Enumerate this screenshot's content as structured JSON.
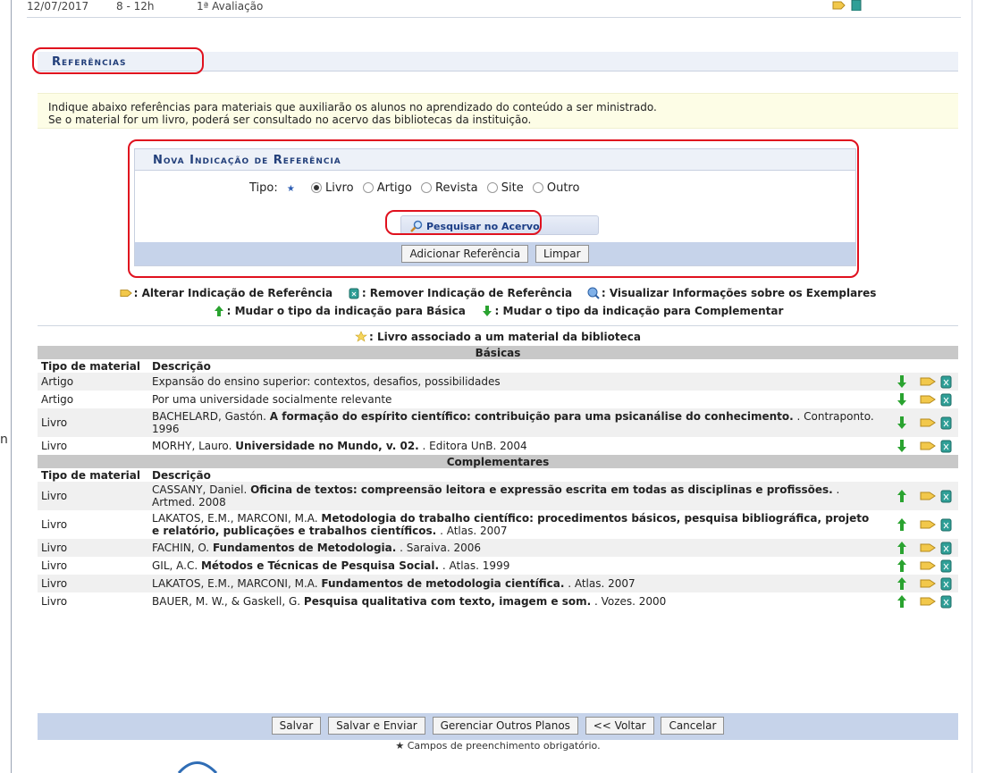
{
  "top_row": {
    "date": "12/07/2017",
    "time": "8 - 12h",
    "desc": "1ª Avaliação"
  },
  "left_margin_text": "n",
  "section_title": "Referências",
  "info_lines": [
    "Indique abaixo referências para materiais que auxiliarão os alunos no aprendizado do conteúdo a ser ministrado.",
    "Se o material for um livro, poderá ser consultado no acervo das bibliotecas da instituição."
  ],
  "form": {
    "title": "Nova Indicação de Referência",
    "tipo_label": "Tipo:",
    "required_mark": "★",
    "options": [
      "Livro",
      "Artigo",
      "Revista",
      "Site",
      "Outro"
    ],
    "selected_option": "Livro",
    "search_button": "Pesquisar no Acervo",
    "add_button": "Adicionar Referência",
    "clear_button": "Limpar"
  },
  "legend": {
    "edit": ": Alterar Indicação de Referência",
    "remove": ": Remover Indicação de Referência",
    "view": ": Visualizar Informações sobre os Exemplares",
    "to_basic": ": Mudar o tipo da indicação para Básica",
    "to_complementary": ": Mudar o tipo da indicação para Complementar",
    "library": ": Livro associado a um material da biblioteca"
  },
  "columns": {
    "type": "Tipo de material",
    "description": "Descrição"
  },
  "groups": [
    {
      "title": "Básicas",
      "arrow": "down",
      "rows": [
        {
          "type": "Artigo",
          "pre": "Expansão do ensino superior: contextos, desafios, possibilidades",
          "bold": "",
          "post": ""
        },
        {
          "type": "Artigo",
          "pre": "Por uma universidade socialmente relevante",
          "bold": "",
          "post": ""
        },
        {
          "type": "Livro",
          "pre": "BACHELARD, Gastón. ",
          "bold": "A formação do espírito científico: contribuição para uma psicanálise do conhecimento.",
          "post": " . Contraponto. 1996"
        },
        {
          "type": "Livro",
          "pre": "MORHY, Lauro. ",
          "bold": "Universidade no Mundo, v. 02.",
          "post": " . Editora UnB. 2004"
        }
      ]
    },
    {
      "title": "Complementares",
      "arrow": "up",
      "rows": [
        {
          "type": "Livro",
          "pre": "CASSANY, Daniel. ",
          "bold": "Oficina de textos: compreensão leitora e expressão escrita em todas as disciplinas e profissões.",
          "post": " . Artmed. 2008"
        },
        {
          "type": "Livro",
          "pre": "LAKATOS, E.M., MARCONI, M.A. ",
          "bold": "Metodologia do trabalho científico: procedimentos básicos, pesquisa bibliográfica, projeto e relatório, publicações e trabalhos científicos.",
          "post": " . Atlas. 2007"
        },
        {
          "type": "Livro",
          "pre": "FACHIN, O. ",
          "bold": "Fundamentos de Metodologia.",
          "post": " . Saraiva. 2006"
        },
        {
          "type": "Livro",
          "pre": "GIL, A.C. ",
          "bold": "Métodos e Técnicas de Pesquisa Social.",
          "post": " . Atlas. 1999"
        },
        {
          "type": "Livro",
          "pre": "LAKATOS, E.M., MARCONI, M.A. ",
          "bold": "Fundamentos de metodologia científica.",
          "post": " . Atlas. 2007"
        },
        {
          "type": "Livro",
          "pre": "BAUER, M. W., & Gaskell, G. ",
          "bold": "Pesquisa qualitativa com texto, imagem e som.",
          "post": " . Vozes. 2000"
        }
      ]
    }
  ],
  "bottom_buttons": [
    "Salvar",
    "Salvar e Enviar",
    "Gerenciar Outros Planos",
    "<< Voltar",
    "Cancelar"
  ],
  "required_note": "★ Campos de preenchimento obrigatório.",
  "colors": {
    "highlight": "#e0111e",
    "title": "#223f7a",
    "bar": "#c6d3ea",
    "group": "#c8c8c8"
  }
}
